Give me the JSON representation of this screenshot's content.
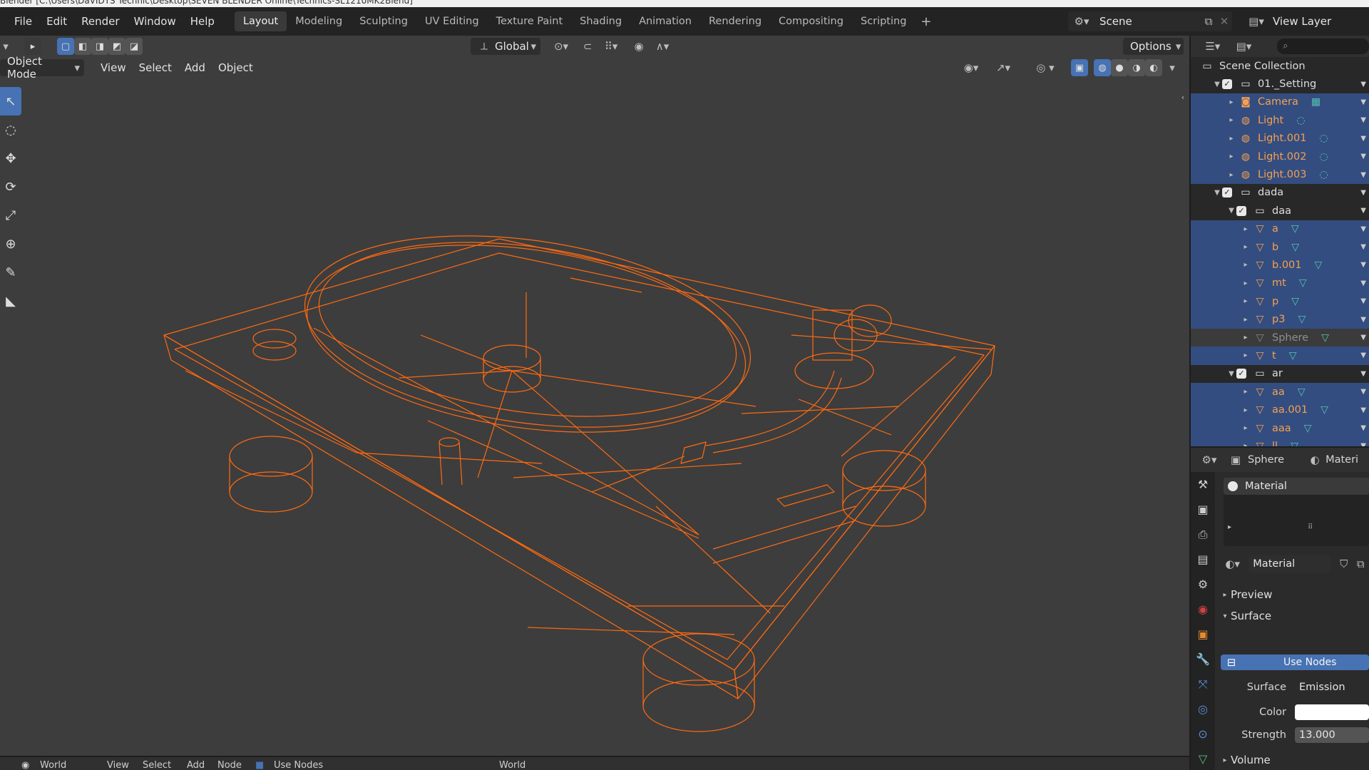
{
  "window_title": "Blender  [C:\\Users\\DaVIDTS Tecnnic\\Desktop\\SEVEN BLENDER Online\\Technics-SL1210MK2Blend]",
  "menu": [
    "File",
    "Edit",
    "Render",
    "Window",
    "Help"
  ],
  "workspaces": [
    {
      "label": "Layout",
      "active": true
    },
    {
      "label": "Modeling",
      "active": false
    },
    {
      "label": "Sculpting",
      "active": false
    },
    {
      "label": "UV Editing",
      "active": false
    },
    {
      "label": "Texture Paint",
      "active": false
    },
    {
      "label": "Shading",
      "active": false
    },
    {
      "label": "Animation",
      "active": false
    },
    {
      "label": "Rendering",
      "active": false
    },
    {
      "label": "Compositing",
      "active": false
    },
    {
      "label": "Scripting",
      "active": false
    }
  ],
  "scene": "Scene",
  "view_layer": "View Layer",
  "viewport": {
    "transform_orientation": "Global",
    "mode": "Object Mode",
    "menu": [
      "View",
      "Select",
      "Add",
      "Object"
    ],
    "options": "Options",
    "wire_color": "#ff6a10",
    "background": "#3d3d3d"
  },
  "tools": [
    "select-box",
    "cursor",
    "move",
    "rotate",
    "scale",
    "transform",
    "annotate",
    "measure"
  ],
  "outliner": {
    "root": "Scene Collection",
    "rows": [
      {
        "indent": 1,
        "expand": "▼",
        "check": true,
        "icon": "collection",
        "label": "01._Setting",
        "kind": "coll",
        "sel": false
      },
      {
        "indent": 2,
        "expand": "▸",
        "check": false,
        "icon": "camera",
        "label": "Camera",
        "kind": "obj",
        "sel": true,
        "data": "camera-data"
      },
      {
        "indent": 2,
        "expand": "▸",
        "check": false,
        "icon": "light",
        "label": "Light",
        "kind": "obj",
        "sel": true,
        "data": "light-data"
      },
      {
        "indent": 2,
        "expand": "▸",
        "check": false,
        "icon": "light",
        "label": "Light.001",
        "kind": "obj",
        "sel": true,
        "data": "light-data"
      },
      {
        "indent": 2,
        "expand": "▸",
        "check": false,
        "icon": "light",
        "label": "Light.002",
        "kind": "obj",
        "sel": true,
        "data": "light-data"
      },
      {
        "indent": 2,
        "expand": "▸",
        "check": false,
        "icon": "light",
        "label": "Light.003",
        "kind": "obj",
        "sel": true,
        "data": "light-data"
      },
      {
        "indent": 1,
        "expand": "▼",
        "check": true,
        "icon": "collection",
        "label": "dada",
        "kind": "coll",
        "sel": false
      },
      {
        "indent": 2,
        "expand": "▼",
        "check": true,
        "icon": "collection",
        "label": "daa",
        "kind": "coll",
        "sel": false
      },
      {
        "indent": 3,
        "expand": "▸",
        "check": false,
        "icon": "mesh",
        "label": "a",
        "kind": "obj",
        "sel": true,
        "data": "mesh-data"
      },
      {
        "indent": 3,
        "expand": "▸",
        "check": false,
        "icon": "mesh",
        "label": "b",
        "kind": "obj",
        "sel": true,
        "data": "mesh-data"
      },
      {
        "indent": 3,
        "expand": "▸",
        "check": false,
        "icon": "mesh",
        "label": "b.001",
        "kind": "obj",
        "sel": true,
        "data": "mesh-data"
      },
      {
        "indent": 3,
        "expand": "▸",
        "check": false,
        "icon": "mesh",
        "label": "mt",
        "kind": "obj",
        "sel": true,
        "data": "mesh-data"
      },
      {
        "indent": 3,
        "expand": "▸",
        "check": false,
        "icon": "mesh",
        "label": "p",
        "kind": "obj",
        "sel": true,
        "data": "mesh-data"
      },
      {
        "indent": 3,
        "expand": "▸",
        "check": false,
        "icon": "mesh",
        "label": "p3",
        "kind": "obj",
        "sel": true,
        "data": "mesh-data"
      },
      {
        "indent": 3,
        "expand": "▸",
        "check": false,
        "icon": "mesh",
        "label": "Sphere",
        "kind": "dim",
        "sel": false,
        "data": "mesh-data"
      },
      {
        "indent": 3,
        "expand": "▸",
        "check": false,
        "icon": "mesh",
        "label": "t",
        "kind": "obj",
        "sel": true,
        "data": "mesh-data"
      },
      {
        "indent": 2,
        "expand": "▼",
        "check": true,
        "icon": "collection",
        "label": "ar",
        "kind": "coll",
        "sel": false
      },
      {
        "indent": 3,
        "expand": "▸",
        "check": false,
        "icon": "mesh",
        "label": "aa",
        "kind": "obj",
        "sel": true,
        "data": "mesh-data"
      },
      {
        "indent": 3,
        "expand": "▸",
        "check": false,
        "icon": "mesh",
        "label": "aa.001",
        "kind": "obj",
        "sel": true,
        "data": "mesh-data"
      },
      {
        "indent": 3,
        "expand": "▸",
        "check": false,
        "icon": "mesh",
        "label": "aaa",
        "kind": "obj",
        "sel": true,
        "data": "mesh-data"
      },
      {
        "indent": 3,
        "expand": "▸",
        "check": false,
        "icon": "mesh",
        "label": "ll",
        "kind": "obj",
        "sel": true,
        "data": "mesh-data"
      }
    ]
  },
  "properties": {
    "object": "Sphere",
    "tab_material": "Materi",
    "slot": "Material",
    "material_name": "Material",
    "panels": {
      "preview": "Preview",
      "surface": "Surface",
      "volume": "Volume"
    },
    "use_nodes": "Use Nodes",
    "surface_label": "Surface",
    "surface_value": "Emission",
    "color_label": "Color",
    "color_value": "#ffffff",
    "strength_label": "Strength",
    "strength_value": "13.000"
  },
  "bottom_bar": {
    "world": "World",
    "menu": [
      "View",
      "Select",
      "Add",
      "Node"
    ],
    "use_nodes": "Use Nodes",
    "world_name": "World"
  }
}
